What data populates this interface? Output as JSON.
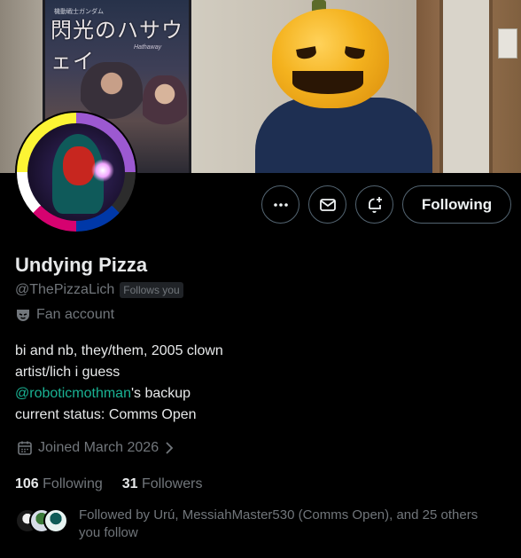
{
  "banner": {
    "poster_title": "閃光のハサウェイ",
    "poster_subtitle": "機動戦士ガンダム",
    "poster_english": "Hathaway"
  },
  "actions": {
    "more_icon": "more-horizontal-icon",
    "message_icon": "envelope-icon",
    "notify_icon": "bell-plus-icon",
    "following_label": "Following"
  },
  "profile": {
    "name": "Undying Pizza",
    "handle": "@ThePizzaLich",
    "follows_you": "Follows you",
    "category_icon": "mask-icon",
    "category": "Fan account",
    "bio": {
      "line1": "bi and nb, they/them, 2005 clown",
      "line2": "artist/lich i guess",
      "mention": "@roboticmothman",
      "mention_suffix": "'s backup",
      "line4": "current status: Comms Open"
    },
    "joined": "Joined March 2026"
  },
  "stats": {
    "following_count": "106",
    "following_label": "Following",
    "followers_count": "31",
    "followers_label": "Followers"
  },
  "followed_by": {
    "text": "Followed by Urú, MessiahMaster530 (Comms Open), and 25 others you follow"
  },
  "colors": {
    "background": "#000000",
    "text": "#e7e9ea",
    "secondary": "#71767b",
    "mention": "#1ab394",
    "button_border": "#536471"
  }
}
